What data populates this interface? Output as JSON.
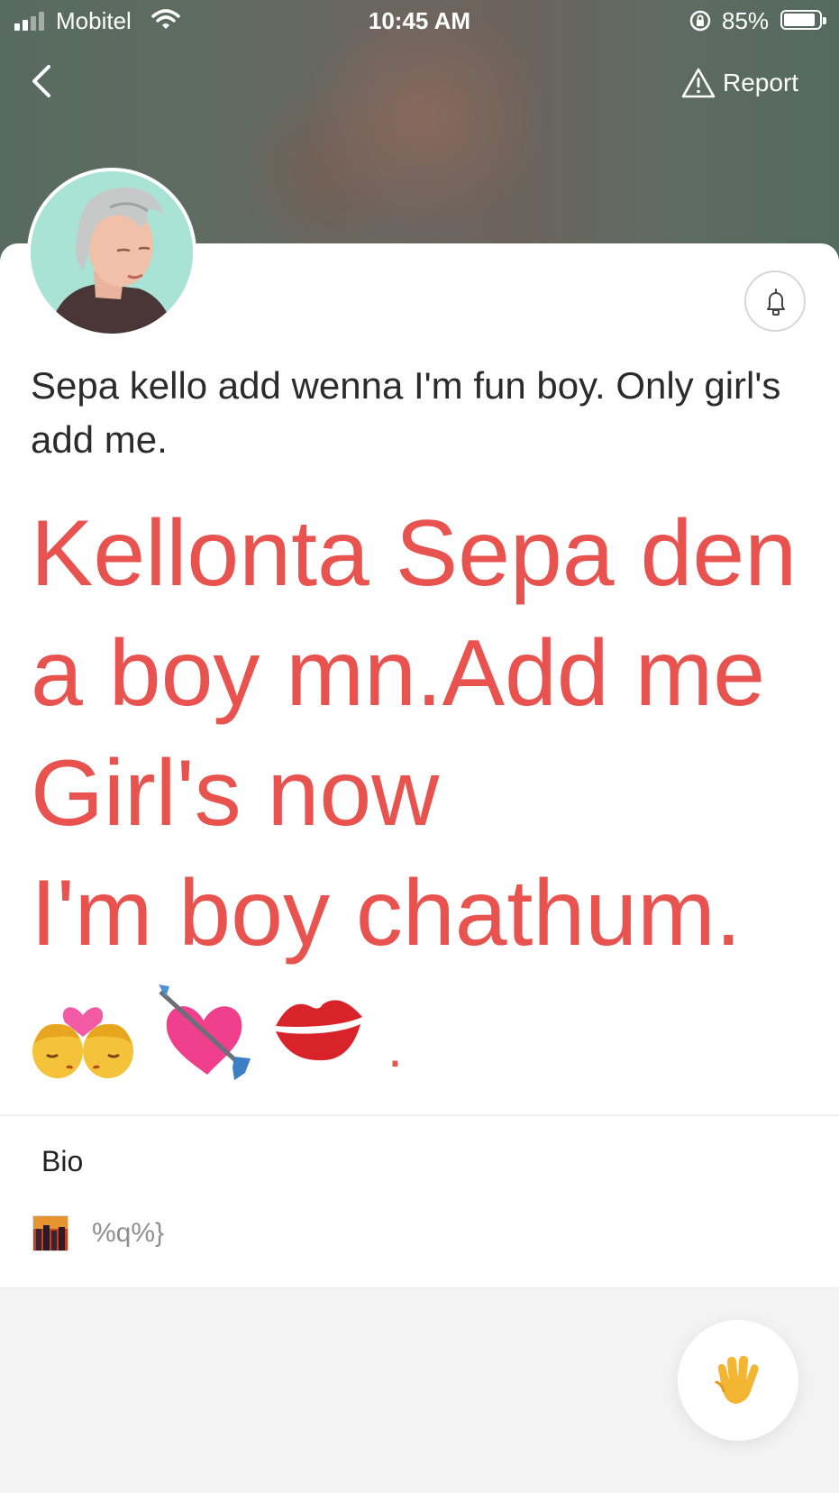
{
  "status_bar": {
    "carrier": "Mobitel",
    "time": "10:45 AM",
    "battery_percent": "85%"
  },
  "header": {
    "report_label": "Report"
  },
  "profile": {
    "short_text": "Sepa kello add wenna I'm fun boy. Only girl's add me.",
    "big_text_lines": [
      "Kellonta Sepa den",
      "a boy mn.Add me",
      "Girl's now",
      "I'm boy chathum."
    ],
    "emoji_icons": [
      "kiss-women-emoji-icon",
      "heart-with-arrow-emoji-icon",
      "kiss-mark-emoji-icon"
    ],
    "trailing_dot": "."
  },
  "bio": {
    "label": "Bio",
    "value": "%q%}"
  },
  "colors": {
    "accent_red": "#e8534f",
    "wave_yellow": "#f2b632"
  }
}
